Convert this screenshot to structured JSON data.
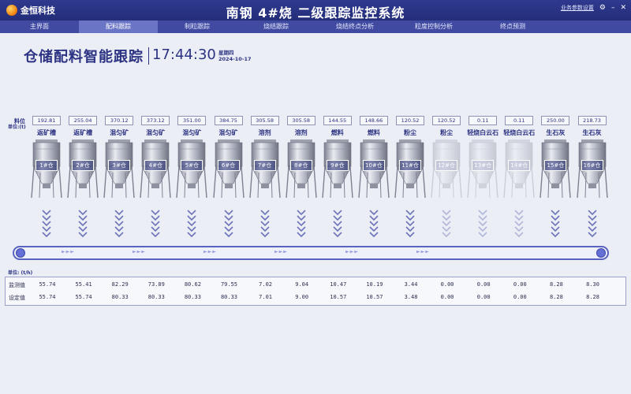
{
  "titlebar": {
    "logo_text": "金恒科技",
    "app_title": "南钢 4#烧 二级跟踪监控系统",
    "settings_link": "业务参数设置",
    "gear_icon": "gear-icon",
    "minimize_icon": "minimize-icon",
    "close_icon": "close-icon"
  },
  "nav": {
    "tabs": [
      {
        "label": "主界面",
        "active": false
      },
      {
        "label": "配料跟踪",
        "active": true
      },
      {
        "label": "制粒跟踪",
        "active": false
      },
      {
        "label": "烧结跟踪",
        "active": false
      },
      {
        "label": "烧结终点分析",
        "active": false
      },
      {
        "label": "粒度控制分析",
        "active": false
      },
      {
        "label": "终点预测",
        "active": false
      }
    ]
  },
  "header": {
    "title": "仓储配料智能跟踪",
    "time": "17:44:30",
    "weekday": "星期四",
    "date": "2024-10-17"
  },
  "labels": {
    "level": "料位",
    "level_unit": "单位:(t)",
    "table_unit": "单位: (t/h)"
  },
  "silos": [
    {
      "name": "1#仓",
      "material": "返矿槽",
      "level": "192.81",
      "active": true
    },
    {
      "name": "2#仓",
      "material": "返矿槽",
      "level": "255.04",
      "active": true
    },
    {
      "name": "3#仓",
      "material": "混匀矿",
      "level": "370.12",
      "active": true
    },
    {
      "name": "4#仓",
      "material": "混匀矿",
      "level": "373.12",
      "active": true
    },
    {
      "name": "5#仓",
      "material": "混匀矿",
      "level": "351.00",
      "active": true
    },
    {
      "name": "6#仓",
      "material": "混匀矿",
      "level": "384.75",
      "active": true
    },
    {
      "name": "7#仓",
      "material": "溶剂",
      "level": "305.58",
      "active": true
    },
    {
      "name": "8#仓",
      "material": "溶剂",
      "level": "305.58",
      "active": true
    },
    {
      "name": "9#仓",
      "material": "燃料",
      "level": "144.55",
      "active": true
    },
    {
      "name": "10#仓",
      "material": "燃料",
      "level": "148.66",
      "active": true
    },
    {
      "name": "11#仓",
      "material": "粉尘",
      "level": "120.52",
      "active": true
    },
    {
      "name": "12#仓",
      "material": "粉尘",
      "level": "120.52",
      "active": false
    },
    {
      "name": "13#仓",
      "material": "轻烧白云石",
      "level": "0.11",
      "active": false
    },
    {
      "name": "14#仓",
      "material": "轻烧白云石",
      "level": "0.11",
      "active": false
    },
    {
      "name": "15#仓",
      "material": "生石灰",
      "level": "250.00",
      "active": true
    },
    {
      "name": "16#仓",
      "material": "生石灰",
      "level": "218.73",
      "active": true
    }
  ],
  "table": {
    "rows": [
      {
        "label": "监测值",
        "values": [
          "55.74",
          "55.41",
          "82.29",
          "73.89",
          "80.62",
          "79.55",
          "7.02",
          "9.04",
          "10.47",
          "10.19",
          "3.44",
          "0.00",
          "0.00",
          "0.00",
          "8.28",
          "8.30"
        ]
      },
      {
        "label": "设定值",
        "values": [
          "55.74",
          "55.74",
          "80.33",
          "80.33",
          "80.33",
          "80.33",
          "7.01",
          "9.00",
          "10.57",
          "10.57",
          "3.48",
          "0.00",
          "0.00",
          "0.00",
          "8.28",
          "8.28"
        ]
      }
    ]
  },
  "colors": {
    "titlebar": "#2f3a8f",
    "navbar": "#3f4aa0",
    "nav_active": "#6a75c6",
    "text_primary": "#2c3382",
    "conveyor": "#5a63c0"
  }
}
